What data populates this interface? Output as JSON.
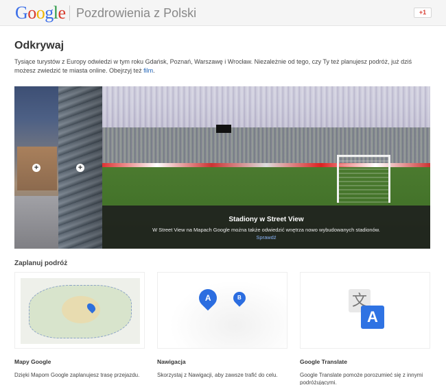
{
  "header": {
    "logo": [
      "G",
      "o",
      "o",
      "g",
      "l",
      "e"
    ],
    "title": "Pozdrowienia z Polski",
    "gplus": "+1"
  },
  "discover": {
    "title": "Odkrywaj",
    "intro": "Tysiące turystów z Europy odwiedzi w tym roku Gdańsk, Poznań, Warszawę i Wrocław. Niezależnie od tego, czy Ty też planujesz podróż, już dziś możesz zwiedzić te miasta online. Obejrzyj też",
    "intro_link": "film",
    "intro_end": "."
  },
  "gallery": {
    "caption_title": "Stadiony w Street View",
    "caption_text": "W Street View na Mapach Google można także odwiedzić wnętrza nowo wybudowanych stadionów.",
    "caption_link": "Sprawdź",
    "plus_label": "+"
  },
  "plan": {
    "title": "Zaplanuj podróż",
    "cards": [
      {
        "label": "Mapy Google",
        "desc": "Dzięki Mapom Google zaplanujesz trasę przejazdu."
      },
      {
        "label": "Nawigacja",
        "desc": "Skorzystaj z Nawigacji, aby zawsze trafić do celu."
      },
      {
        "label": "Google Translate",
        "desc": "Google Translate pomoże porozumieć się z innymi podróżującymi."
      }
    ],
    "nav_pins": [
      "A",
      "B"
    ],
    "translate_glyphs": [
      "文",
      "A"
    ]
  },
  "colors": {
    "logo_blue": "#3b6ee8",
    "logo_red": "#d83a2b",
    "logo_yellow": "#f0b400",
    "logo_green": "#2d9a47",
    "link": "#1a5fb4",
    "pin_blue": "#2b6de0"
  }
}
